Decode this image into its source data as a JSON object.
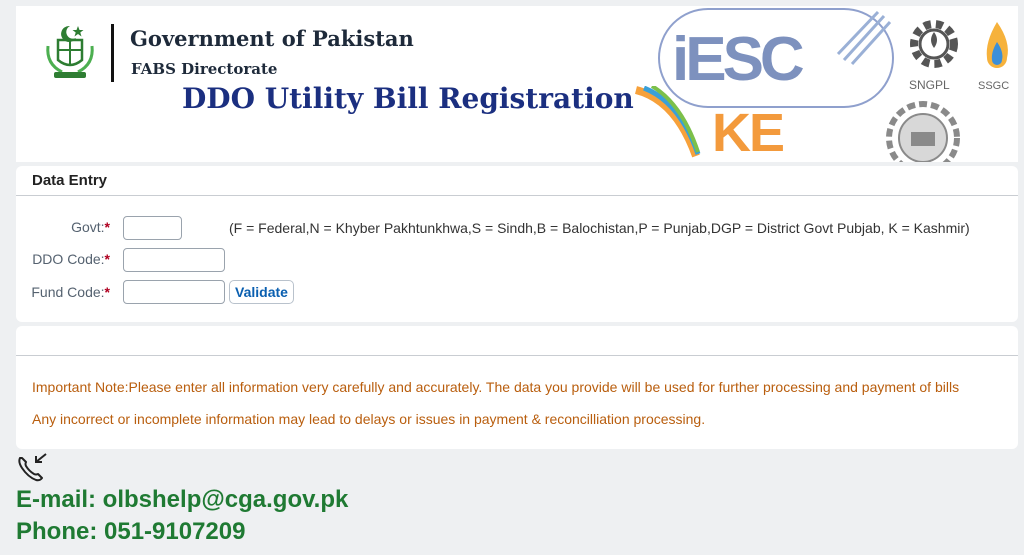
{
  "header": {
    "gov_title": "Government of Pakistan",
    "gov_subtitle": "FABS Directorate",
    "main_title": "DDO Utility Bill Registration",
    "logos": {
      "iesco": "iESC",
      "ke": "KE",
      "sngpl": "SNGPL",
      "ssgc": "SSGC"
    }
  },
  "data_entry": {
    "title": "Data Entry",
    "fields": {
      "govt": {
        "label": "Govt:",
        "required": "*",
        "value": ""
      },
      "ddo_code": {
        "label": "DDO Code:",
        "required": "*",
        "value": ""
      },
      "fund_code": {
        "label": "Fund Code:",
        "required": "*",
        "value": ""
      }
    },
    "govt_hint": "(F = Federal,N = Khyber Pakhtunkhwa,S = Sindh,B = Balochistan,P = Punjab,DGP = District Govt Pubjab, K = Kashmir)",
    "validate_label": "Validate"
  },
  "notes": {
    "line1": "Important Note:Please enter all information very carefully and accurately. The data you provide will be used for further processing and payment of bills",
    "line2": "Any incorrect or incomplete information may lead to delays or issues in payment & reconcilliation processing."
  },
  "contact": {
    "icon": "phone-incoming-icon",
    "email": "E-mail: olbshelp@cga.gov.pk",
    "phone": "Phone: 051-9107209"
  },
  "colors": {
    "title_blue": "#1b2f80",
    "note_orange": "#b95e0e",
    "contact_green": "#1f7a33",
    "required_red": "#b00020"
  }
}
